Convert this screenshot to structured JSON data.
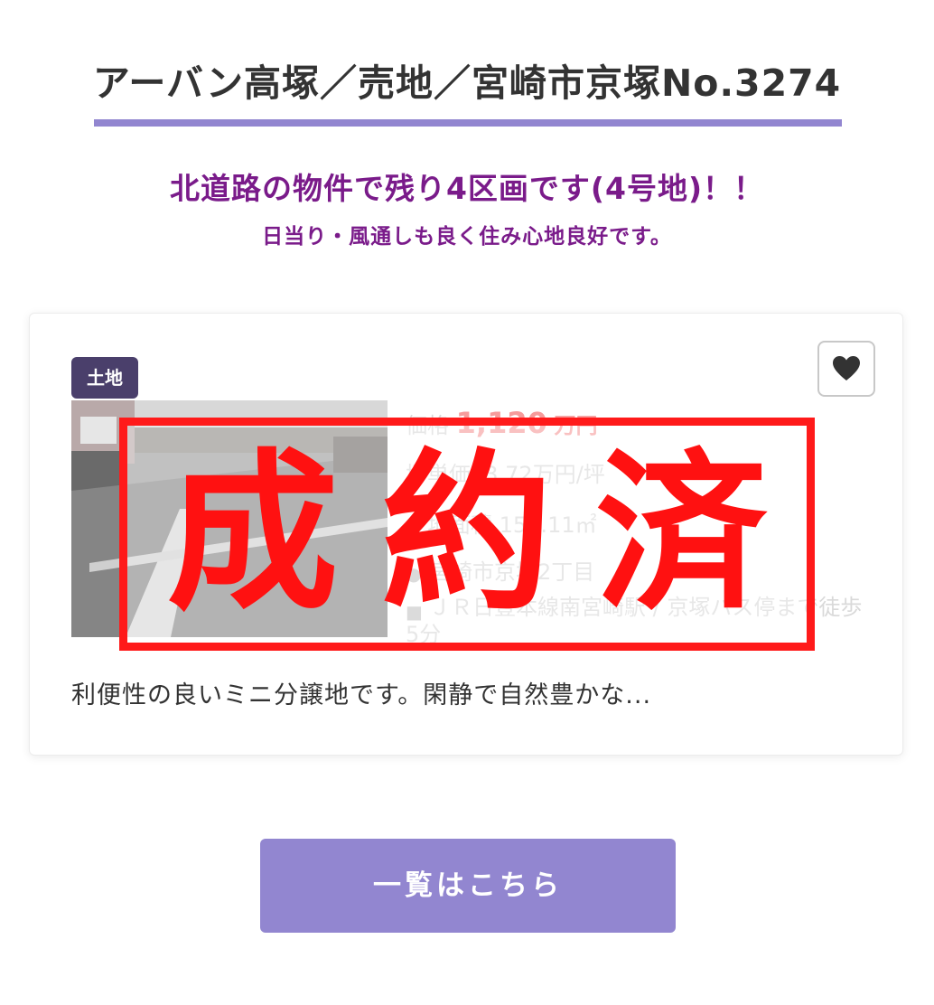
{
  "header": {
    "title": "アーバン高塚／売地／宮崎市京塚No.3274",
    "headline": "北道路の物件で残り4区画です(4号地)！！",
    "subheadline": "日当り・風通しも良く住み心地良好です。"
  },
  "listing": {
    "category": "土地",
    "price_label": "価格",
    "price_value": "1,120",
    "price_unit": "万円",
    "tsubo_price": "坪単価23.72万円/坪",
    "land_area": "土地面積 156.11㎡",
    "address": "宮崎市京塚2丁目",
    "access": "ＪＲ日豊本線南宮崎駅 / 京塚バス停まで徒歩5分",
    "description": "利便性の良いミニ分譲地です。閑静で自然豊かな...",
    "sold_stamp": "成約済",
    "favorite_icon": "heart-icon"
  },
  "actions": {
    "list_button_label": "一覧はこちら"
  },
  "colors": {
    "accent": "#9286d0",
    "headline": "#7a1b8a",
    "badge": "#4a3f6b",
    "price": "#f04a4a",
    "stamp": "#ff1111"
  }
}
